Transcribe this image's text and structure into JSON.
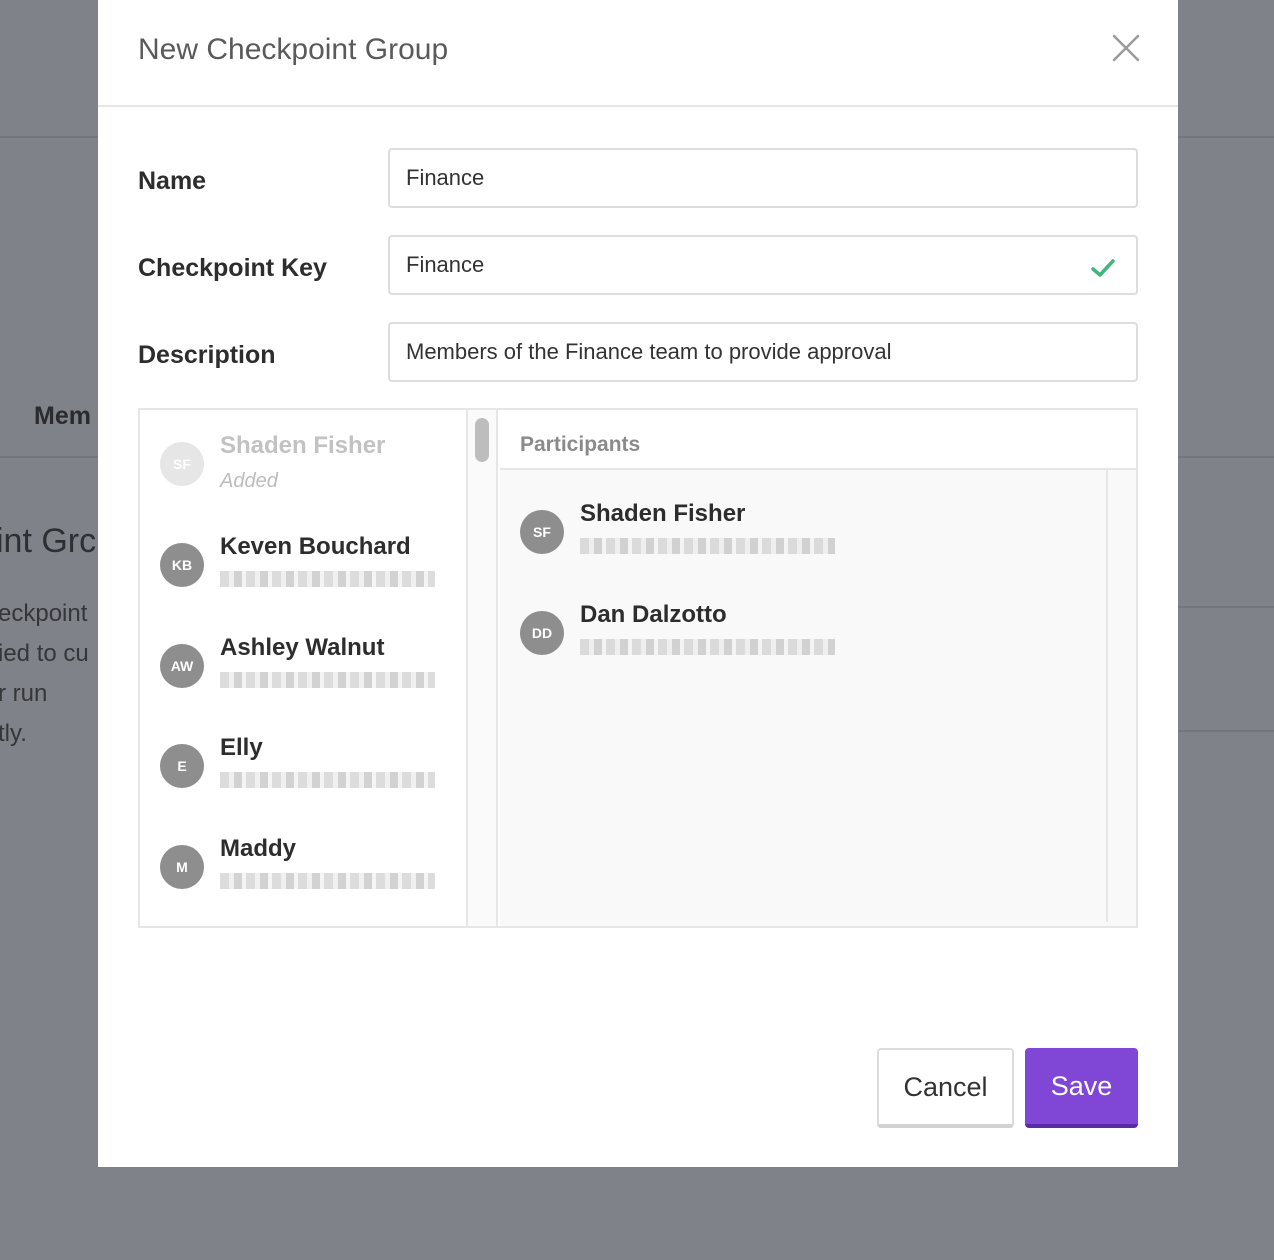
{
  "background": {
    "tab_label": "Mem",
    "heading": "int Grc",
    "text_lines": [
      "eckpoint",
      "ied to cu",
      "r run",
      "tly."
    ]
  },
  "modal": {
    "title": "New Checkpoint Group",
    "close_icon": "close-icon",
    "fields": {
      "name": {
        "label": "Name",
        "value": "Finance"
      },
      "checkpoint_key": {
        "label": "Checkpoint Key",
        "value": "Finance",
        "valid_icon": "check-icon"
      },
      "description": {
        "label": "Description",
        "value": "Members of the Finance team to provide approval"
      }
    },
    "people": [
      {
        "initials": "SF",
        "name": "Shaden Fisher",
        "status": "Added"
      },
      {
        "initials": "KB",
        "name": "Keven Bouchard"
      },
      {
        "initials": "AW",
        "name": "Ashley Walnut"
      },
      {
        "initials": "E",
        "name": "Elly"
      },
      {
        "initials": "M",
        "name": "Maddy"
      }
    ],
    "participants": {
      "title": "Participants",
      "items": [
        {
          "initials": "SF",
          "name": "Shaden Fisher"
        },
        {
          "initials": "DD",
          "name": "Dan Dalzotto"
        }
      ]
    },
    "buttons": {
      "cancel": "Cancel",
      "save": "Save"
    }
  },
  "colors": {
    "overlay": "#808289",
    "accent": "#8046d5",
    "valid": "#3fb67a",
    "avatar": "#8e8e8e"
  }
}
